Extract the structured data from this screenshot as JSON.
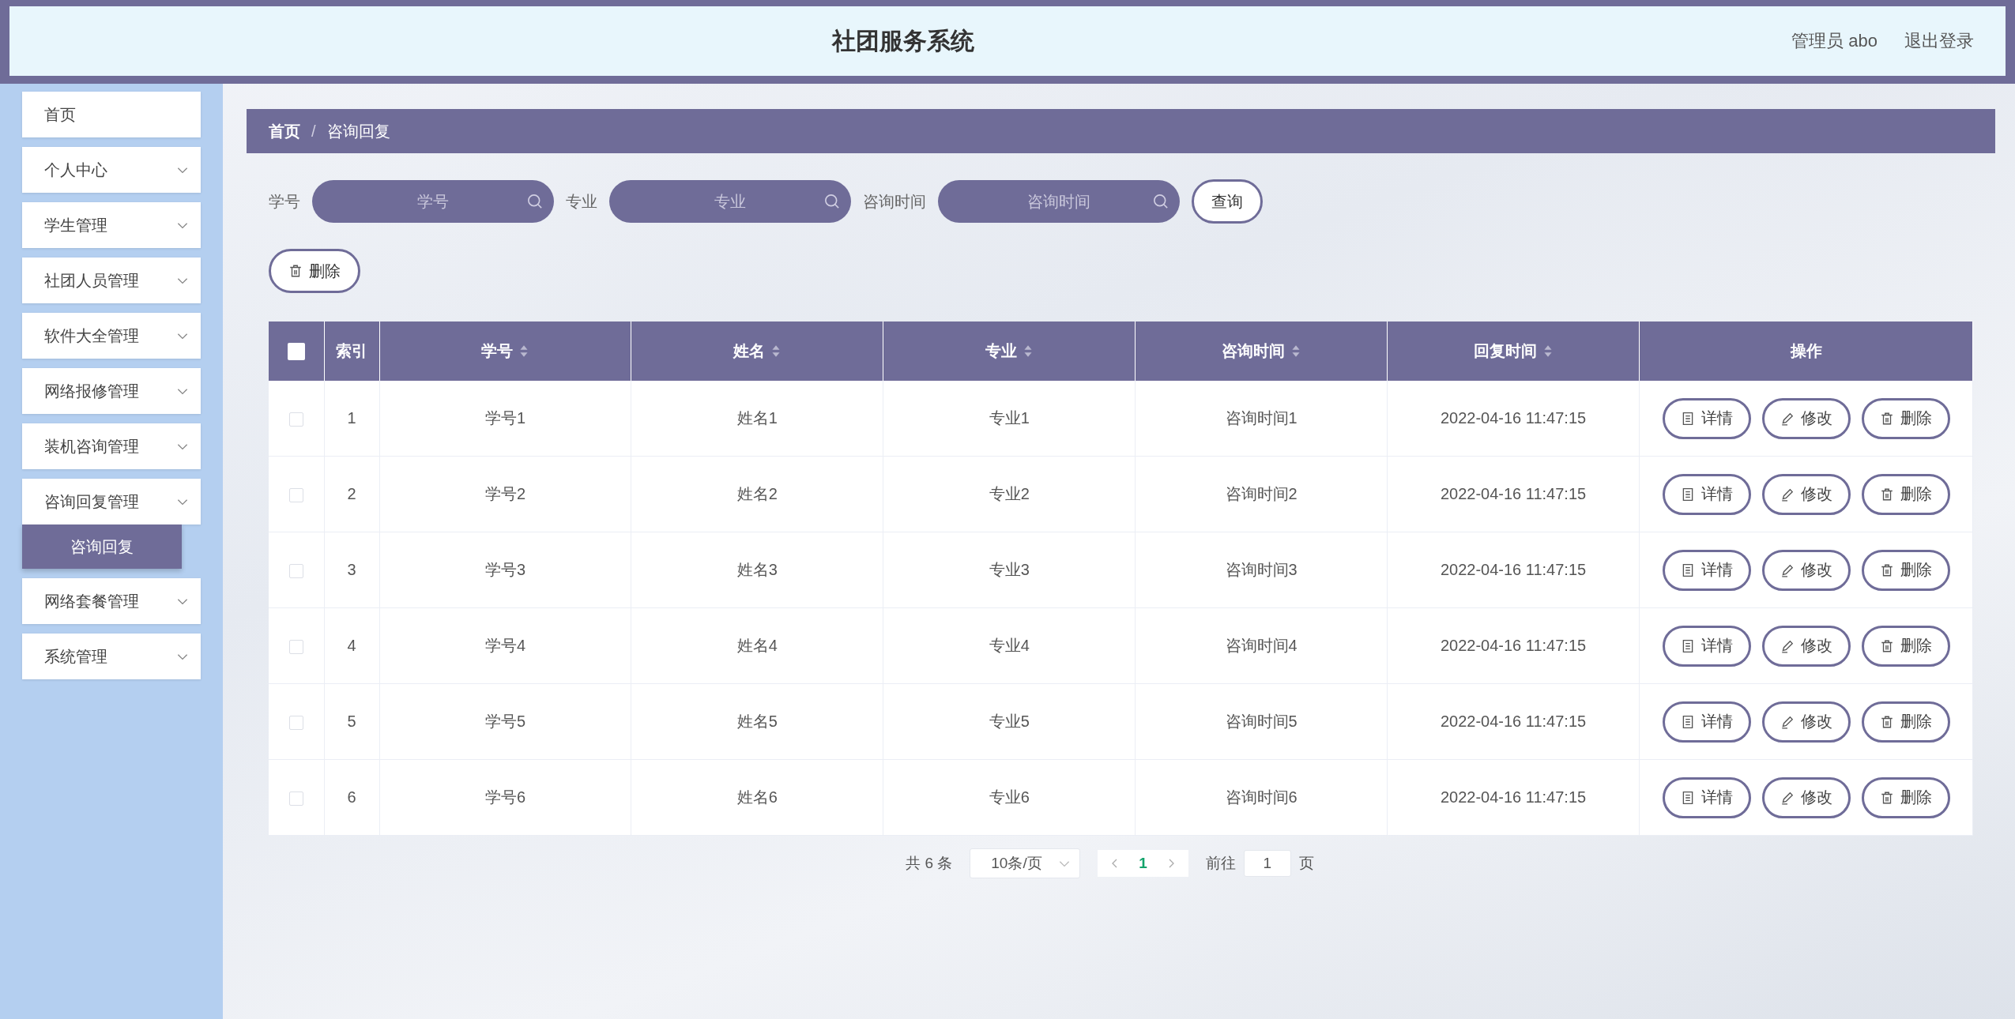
{
  "header": {
    "title": "社团服务系统",
    "user": "管理员 abo",
    "logout": "退出登录"
  },
  "sidebar": {
    "items": [
      {
        "label": "首页",
        "kind": "link"
      },
      {
        "label": "个人中心",
        "kind": "menu"
      },
      {
        "label": "学生管理",
        "kind": "menu"
      },
      {
        "label": "社团人员管理",
        "kind": "menu"
      },
      {
        "label": "软件大全管理",
        "kind": "menu"
      },
      {
        "label": "网络报修管理",
        "kind": "menu"
      },
      {
        "label": "装机咨询管理",
        "kind": "menu"
      },
      {
        "label": "咨询回复管理",
        "kind": "menu",
        "children": [
          {
            "label": "咨询回复",
            "selected": true
          }
        ]
      },
      {
        "label": "网络套餐管理",
        "kind": "menu"
      },
      {
        "label": "系统管理",
        "kind": "menu"
      }
    ]
  },
  "breadcrumb": {
    "items": [
      "首页",
      "咨询回复"
    ],
    "separator": "/"
  },
  "search": {
    "fields": [
      {
        "label": "学号",
        "placeholder": "学号"
      },
      {
        "label": "专业",
        "placeholder": "专业"
      },
      {
        "label": "咨询时间",
        "placeholder": "咨询时间"
      }
    ],
    "button": "查询"
  },
  "toolbar": {
    "delete": "删除"
  },
  "table": {
    "select_all": false,
    "columns": [
      {
        "label": "索引",
        "sortable": false
      },
      {
        "label": "学号",
        "sortable": true
      },
      {
        "label": "姓名",
        "sortable": true
      },
      {
        "label": "专业",
        "sortable": true
      },
      {
        "label": "咨询时间",
        "sortable": true
      },
      {
        "label": "回复时间",
        "sortable": true
      },
      {
        "label": "操作",
        "sortable": false
      }
    ],
    "rows": [
      {
        "checked": false,
        "cells": [
          "1",
          "学号1",
          "姓名1",
          "专业1",
          "咨询时间1",
          "2022-04-16 11:47:15"
        ],
        "actions": [
          {
            "kind": "detail",
            "label": "详情"
          },
          {
            "kind": "edit",
            "label": "修改"
          },
          {
            "kind": "delete",
            "label": "删除"
          }
        ]
      },
      {
        "checked": false,
        "cells": [
          "2",
          "学号2",
          "姓名2",
          "专业2",
          "咨询时间2",
          "2022-04-16 11:47:15"
        ],
        "actions": [
          {
            "kind": "detail",
            "label": "详情"
          },
          {
            "kind": "edit",
            "label": "修改"
          },
          {
            "kind": "delete",
            "label": "删除"
          }
        ]
      },
      {
        "checked": false,
        "cells": [
          "3",
          "学号3",
          "姓名3",
          "专业3",
          "咨询时间3",
          "2022-04-16 11:47:15"
        ],
        "actions": [
          {
            "kind": "detail",
            "label": "详情"
          },
          {
            "kind": "edit",
            "label": "修改"
          },
          {
            "kind": "delete",
            "label": "删除"
          }
        ]
      },
      {
        "checked": false,
        "cells": [
          "4",
          "学号4",
          "姓名4",
          "专业4",
          "咨询时间4",
          "2022-04-16 11:47:15"
        ],
        "actions": [
          {
            "kind": "detail",
            "label": "详情"
          },
          {
            "kind": "edit",
            "label": "修改"
          },
          {
            "kind": "delete",
            "label": "删除"
          }
        ]
      },
      {
        "checked": false,
        "cells": [
          "5",
          "学号5",
          "姓名5",
          "专业5",
          "咨询时间5",
          "2022-04-16 11:47:15"
        ],
        "actions": [
          {
            "kind": "detail",
            "label": "详情"
          },
          {
            "kind": "edit",
            "label": "修改"
          },
          {
            "kind": "delete",
            "label": "删除"
          }
        ]
      },
      {
        "checked": false,
        "cells": [
          "6",
          "学号6",
          "姓名6",
          "专业6",
          "咨询时间6",
          "2022-04-16 11:47:15"
        ],
        "actions": [
          {
            "kind": "detail",
            "label": "详情"
          },
          {
            "kind": "edit",
            "label": "修改"
          },
          {
            "kind": "delete",
            "label": "删除"
          }
        ]
      }
    ]
  },
  "pagination": {
    "total": "共 6 条",
    "page_size": "10条/页",
    "pages": [
      {
        "label": "1",
        "selected": true
      }
    ],
    "goto_label": "前往",
    "goto_value": "1",
    "goto_suffix": "页"
  }
}
